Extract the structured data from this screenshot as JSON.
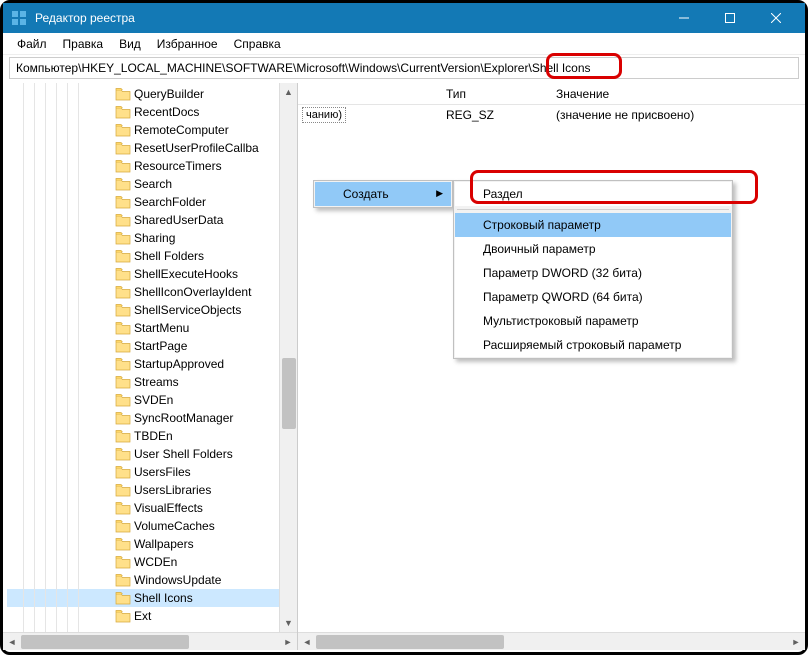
{
  "window": {
    "title": "Редактор реестра"
  },
  "menu": {
    "file": "Файл",
    "edit": "Правка",
    "view": "Вид",
    "favorites": "Избранное",
    "help": "Справка"
  },
  "address": {
    "prefix": "Компьютер\\HKEY_LOCAL_MACHINE\\SOFTWARE\\Microsoft\\Windows\\CurrentVersion\\Explorer",
    "last": "Shell Icons"
  },
  "tree": {
    "items": [
      "QueryBuilder",
      "RecentDocs",
      "RemoteComputer",
      "ResetUserProfileCallba",
      "ResourceTimers",
      "Search",
      "SearchFolder",
      "SharedUserData",
      "Sharing",
      "Shell Folders",
      "ShellExecuteHooks",
      "ShellIconOverlayIdent",
      "ShellServiceObjects",
      "StartMenu",
      "StartPage",
      "StartupApproved",
      "Streams",
      "SVDEn",
      "SyncRootManager",
      "TBDEn",
      "User Shell Folders",
      "UsersFiles",
      "UsersLibraries",
      "VisualEffects",
      "VolumeCaches",
      "Wallpapers",
      "WCDEn",
      "WindowsUpdate",
      "Shell Icons",
      "Ext"
    ],
    "selected_index": 28
  },
  "columns": {
    "type": "Тип",
    "value": "Значение"
  },
  "row_default": {
    "label_suffix": "чанию)",
    "type": "REG_SZ",
    "value": "(значение не присвоено)"
  },
  "context": {
    "create": "Создать"
  },
  "submenu": {
    "items": [
      "Раздел",
      "Строковый параметр",
      "Двоичный параметр",
      "Параметр DWORD (32 бита)",
      "Параметр QWORD (64 бита)",
      "Мультистроковый параметр",
      "Расширяемый строковый параметр"
    ],
    "highlight_index": 1
  }
}
